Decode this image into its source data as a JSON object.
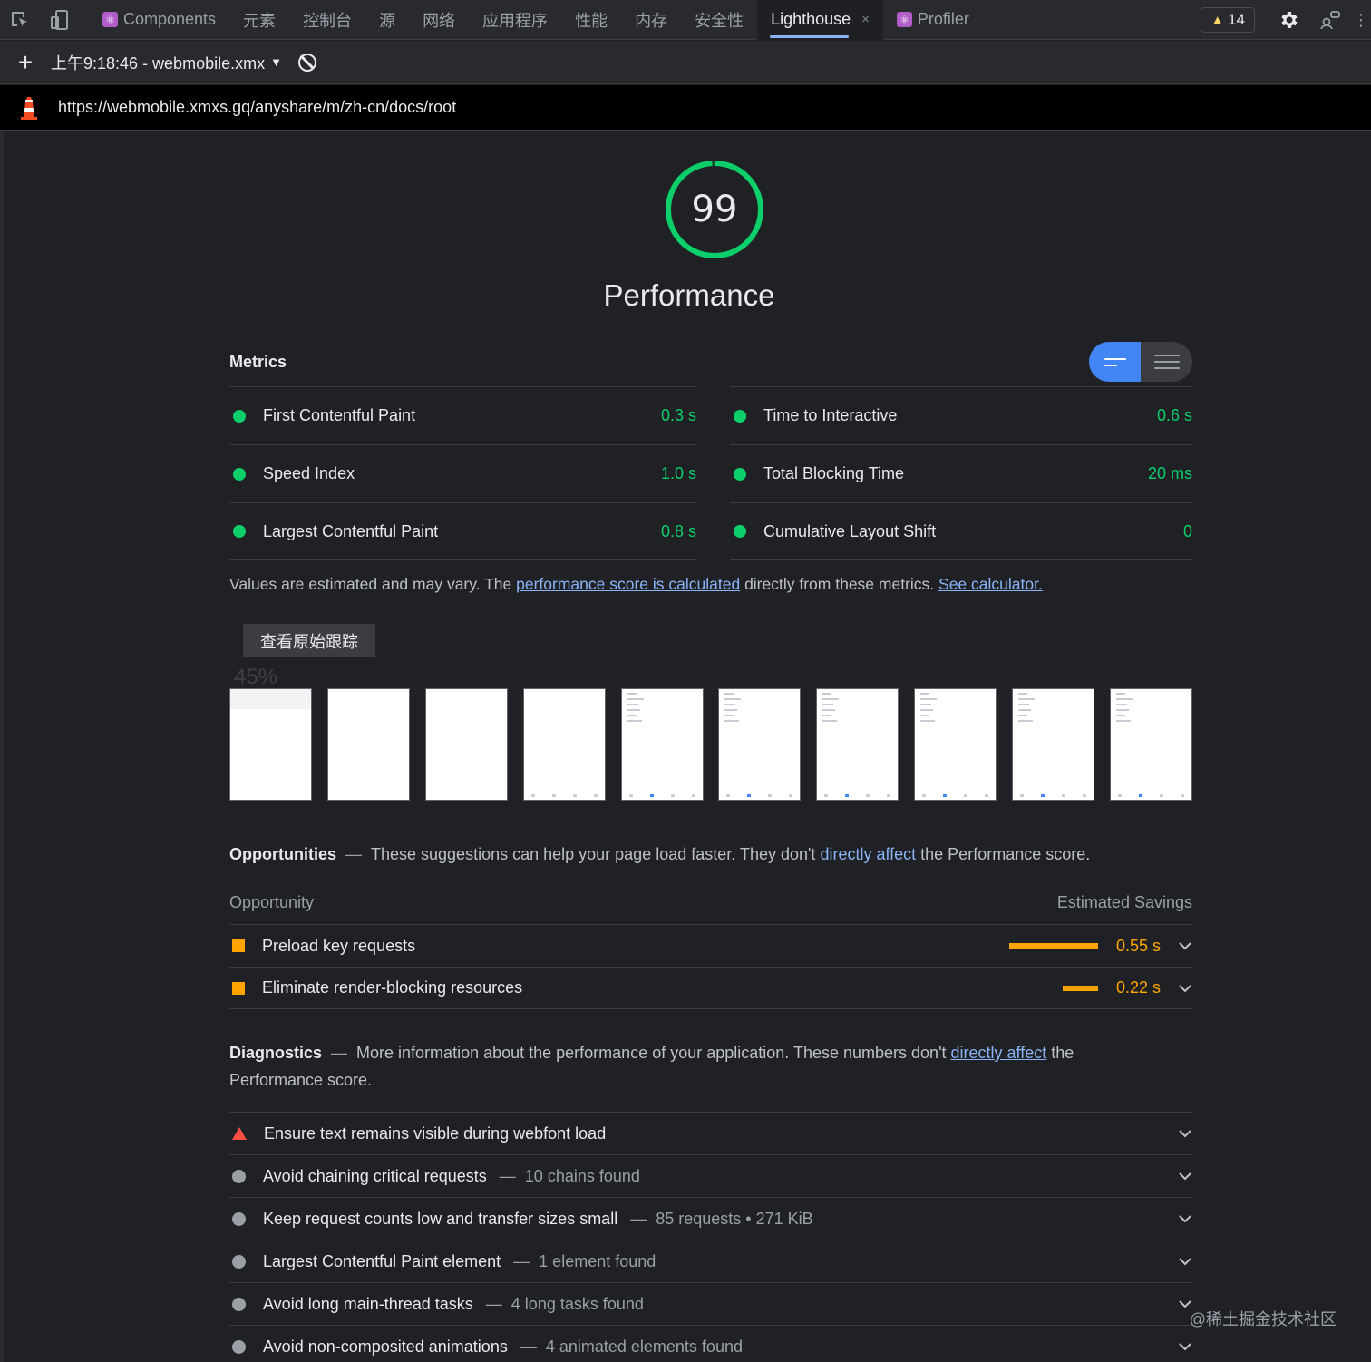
{
  "tabs": {
    "items": [
      {
        "label": "Components",
        "react": true
      },
      {
        "label": "元素"
      },
      {
        "label": "控制台"
      },
      {
        "label": "源"
      },
      {
        "label": "网络"
      },
      {
        "label": "应用程序"
      },
      {
        "label": "性能"
      },
      {
        "label": "内存"
      },
      {
        "label": "安全性"
      },
      {
        "label": "Lighthouse",
        "active": true,
        "close": "×"
      },
      {
        "label": "Profiler",
        "react": true
      }
    ],
    "warning_count": "14"
  },
  "toolbar": {
    "add_label": "+",
    "report_label": "上午9:18:46 - webmobile.xmx",
    "caret": "▼"
  },
  "url": "https://webmobile.xmxs.gq/anyshare/m/zh-cn/docs/root",
  "gauge": {
    "score": "99",
    "title": "Performance",
    "fraction": 0.99,
    "color": "#0cce6b"
  },
  "metrics": {
    "heading": "Metrics",
    "items": [
      {
        "name": "First Contentful Paint",
        "value": "0.3 s"
      },
      {
        "name": "Time to Interactive",
        "value": "0.6 s"
      },
      {
        "name": "Speed Index",
        "value": "1.0 s"
      },
      {
        "name": "Total Blocking Time",
        "value": "20 ms"
      },
      {
        "name": "Largest Contentful Paint",
        "value": "0.8 s"
      },
      {
        "name": "Cumulative Layout Shift",
        "value": "0"
      }
    ],
    "note_prefix": "Values are estimated and may vary. The ",
    "note_link1": "performance score is calculated",
    "note_middle": " directly from these metrics. ",
    "note_link2": "See calculator."
  },
  "trace_button": "查看原始跟踪",
  "ghost_percent": "45%",
  "opportunities": {
    "heading": "Opportunities",
    "desc_prefix": "These suggestions can help your page load faster. They don't ",
    "desc_link": "directly affect",
    "desc_suffix": " the Performance score.",
    "col_opportunity": "Opportunity",
    "col_savings": "Estimated Savings",
    "items": [
      {
        "name": "Preload key requests",
        "savings": "0.55 s",
        "bar_fraction": 1.0
      },
      {
        "name": "Eliminate render-blocking resources",
        "savings": "0.22 s",
        "bar_fraction": 0.4
      }
    ]
  },
  "diagnostics": {
    "heading": "Diagnostics",
    "desc_prefix": "More information about the performance of your application. These numbers don't ",
    "desc_link": "directly affect",
    "desc_suffix": " the Performance score.",
    "items": [
      {
        "name": "Ensure text remains visible during webfont load",
        "detail": "",
        "status": "fail"
      },
      {
        "name": "Avoid chaining critical requests",
        "detail": "10 chains found",
        "status": "info"
      },
      {
        "name": "Keep request counts low and transfer sizes small",
        "detail": "85 requests • 271 KiB",
        "status": "info"
      },
      {
        "name": "Largest Contentful Paint element",
        "detail": "1 element found",
        "status": "info"
      },
      {
        "name": "Avoid long main-thread tasks",
        "detail": "4 long tasks found",
        "status": "info"
      },
      {
        "name": "Avoid non-composited animations",
        "detail": "4 animated elements found",
        "status": "info"
      }
    ]
  },
  "watermark": "@稀土掘金技术社区",
  "colors": {
    "pass": "#0cce6b",
    "average": "#ffa400",
    "fail": "#ff4e42",
    "link": "#8ab4f8"
  }
}
